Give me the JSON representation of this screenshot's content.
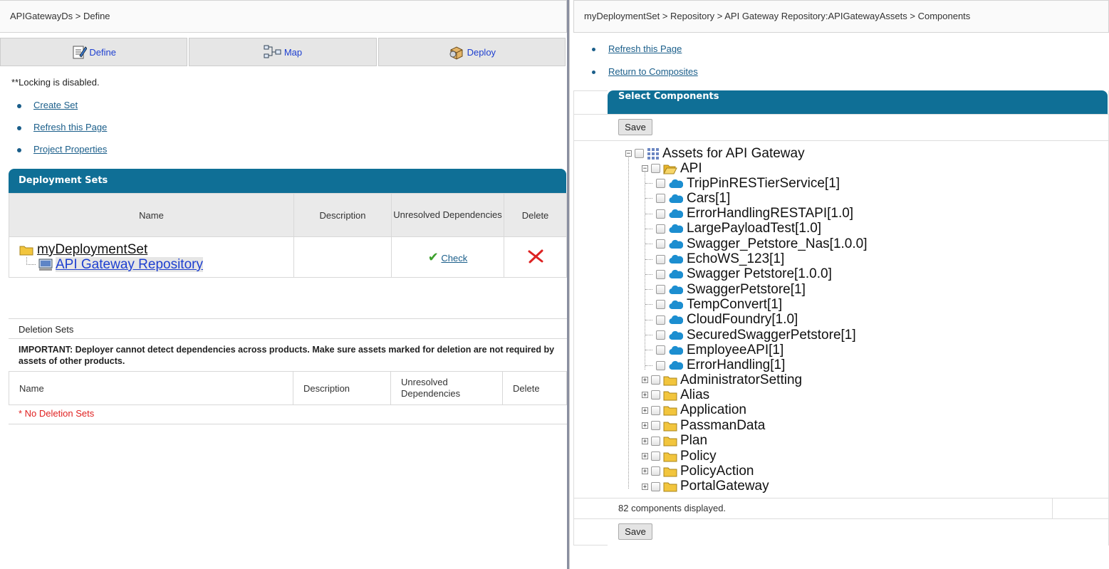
{
  "left": {
    "breadcrumb": "APIGatewayDs > Define",
    "tabs": [
      {
        "label": "Define",
        "icon": "define-icon"
      },
      {
        "label": "Map",
        "icon": "map-icon"
      },
      {
        "label": "Deploy",
        "icon": "deploy-icon"
      }
    ],
    "locking_note": "**Locking is disabled.",
    "links": [
      "Create Set",
      "Refresh this Page",
      "Project Properties"
    ],
    "deployment_sets": {
      "title": "Deployment Sets",
      "columns": [
        "Name",
        "Description",
        "Unresolved Dependencies",
        "Delete"
      ],
      "set_name": "myDeploymentSet",
      "repository": "API Gateway Repository",
      "check_label": "Check"
    },
    "deletion_sets": {
      "title": "Deletion Sets",
      "important": "IMPORTANT: Deployer cannot detect dependencies across products. Make sure assets marked for deletion are not required by assets of other products.",
      "columns": [
        "Name",
        "Description",
        "Unresolved Dependencies",
        "Delete"
      ],
      "empty": "* No Deletion Sets"
    }
  },
  "right": {
    "breadcrumb": "myDeploymentSet > Repository > API Gateway Repository:APIGatewayAssets > Components",
    "links": [
      "Refresh this Page",
      "Return to Composites"
    ],
    "panel_title": "Select Components",
    "save_label": "Save",
    "tree": {
      "root": "Assets for API Gateway",
      "api_folder": "API",
      "api_items": [
        "TripPinRESTierService[1]",
        "Cars[1]",
        "ErrorHandlingRESTAPI[1.0]",
        "LargePayloadTest[1.0]",
        "Swagger_Petstore_Nas[1.0.0]",
        "EchoWS_123[1]",
        "Swagger Petstore[1.0.0]",
        "SwaggerPetstore[1]",
        "TempConvert[1]",
        "CloudFoundry[1.0]",
        "SecuredSwaggerPetstore[1]",
        "EmployeeAPI[1]",
        "ErrorHandling[1]"
      ],
      "other_folders": [
        "AdministratorSetting",
        "Alias",
        "Application",
        "PassmanData",
        "Plan",
        "Policy",
        "PolicyAction",
        "PortalGateway"
      ]
    },
    "status": "82 components displayed."
  },
  "colors": {
    "header": "#0f6f96",
    "link": "#1a5e8a",
    "error": "#e02020",
    "check": "#3ca02c",
    "cloud": "#1c8ed0",
    "folder": "#f2c53d"
  }
}
